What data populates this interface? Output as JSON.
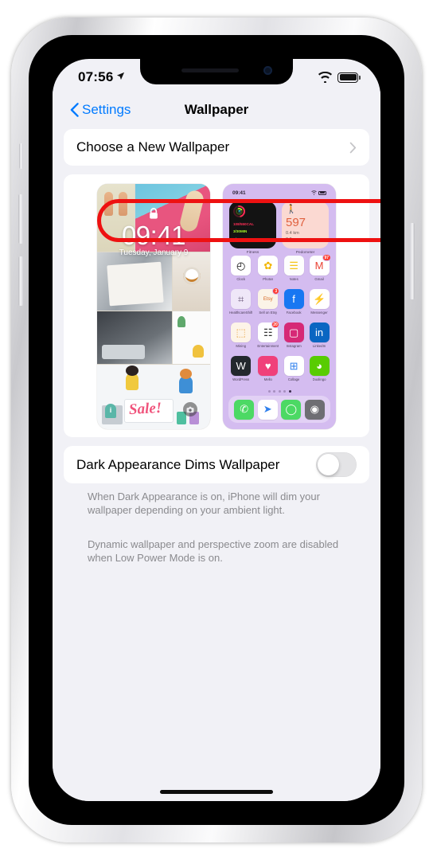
{
  "status_bar": {
    "time": "07:56",
    "location_icon": "location-arrow-icon",
    "wifi_icon": "wifi-icon",
    "battery_icon": "battery-full-icon"
  },
  "nav": {
    "back_label": "Settings",
    "back_icon": "chevron-left-icon",
    "title": "Wallpaper"
  },
  "choose_wallpaper": {
    "label": "Choose a New Wallpaper",
    "chevron_icon": "chevron-right-icon"
  },
  "lock_preview": {
    "time": "09:41",
    "date": "Tuesday, January 9",
    "lock_icon": "lock-icon",
    "camera_icon": "camera-icon",
    "sale_text": "Sale!",
    "info_badge": "i"
  },
  "home_preview": {
    "status_time": "09:41",
    "widgets": [
      {
        "name": "fitness-widget",
        "caption": "Fitness",
        "move": "108/550",
        "move_unit": "CAL",
        "exercise": "3/30",
        "exercise_unit": "MIN",
        "stand": "7/12",
        "stand_unit": "HRS"
      },
      {
        "name": "pedometer-widget",
        "caption": "Pedometer",
        "walk_icon": "walking-person-icon",
        "steps": "597",
        "distance": "0.4 km",
        "floors": "0 floors"
      }
    ],
    "apps": [
      {
        "label": "Clock",
        "icon": "clock-icon",
        "glyph": "◴",
        "bg": "#ffffff",
        "fg": "#111111",
        "badge": ""
      },
      {
        "label": "Photos",
        "icon": "photos-icon",
        "glyph": "✿",
        "bg": "#ffffff",
        "fg": "#f2b600",
        "badge": ""
      },
      {
        "label": "Notes",
        "icon": "notes-icon",
        "glyph": "☰",
        "bg": "#fdfdfd",
        "fg": "#f5c518",
        "badge": ""
      },
      {
        "label": "Gmail",
        "icon": "gmail-icon",
        "glyph": "M",
        "bg": "#ffffff",
        "fg": "#ea4335",
        "badge": "97"
      },
      {
        "label": "HealthcareShift",
        "icon": "folder-icon",
        "glyph": "⌗",
        "bg": "#efe7f8",
        "fg": "#6a5a7a",
        "badge": ""
      },
      {
        "label": "Sell on Etsy",
        "icon": "etsy-icon",
        "glyph": "Etsy",
        "bg": "#fbf4e7",
        "fg": "#d5641e",
        "badge": "3"
      },
      {
        "label": "Facebook",
        "icon": "facebook-icon",
        "glyph": "f",
        "bg": "#1877f2",
        "fg": "#ffffff",
        "badge": ""
      },
      {
        "label": "Messenger",
        "icon": "messenger-icon",
        "glyph": "⚡",
        "bg": "#ffffff",
        "fg": "#a033ff",
        "badge": ""
      },
      {
        "label": "Mining",
        "icon": "mining-icon",
        "glyph": "⬚",
        "bg": "#fdf4e8",
        "fg": "#e8a33d",
        "badge": ""
      },
      {
        "label": "Entertainment",
        "icon": "entertainment-icon",
        "glyph": "☷",
        "bg": "#ffffff",
        "fg": "#333333",
        "badge": "20"
      },
      {
        "label": "Instagram",
        "icon": "instagram-icon",
        "glyph": "▢",
        "bg": "#d62976",
        "fg": "#ffffff",
        "badge": ""
      },
      {
        "label": "LinkedIn",
        "icon": "linkedin-icon",
        "glyph": "in",
        "bg": "#0a66c2",
        "fg": "#ffffff",
        "badge": ""
      },
      {
        "label": "WordPress",
        "icon": "wordpress-icon",
        "glyph": "W",
        "bg": "#23282d",
        "fg": "#ffffff",
        "badge": ""
      },
      {
        "label": "Mello",
        "icon": "mello-icon",
        "glyph": "♥",
        "bg": "#f0407a",
        "fg": "#ffffff",
        "badge": ""
      },
      {
        "label": "Collage",
        "icon": "collage-icon",
        "glyph": "⊞",
        "bg": "#ffffff",
        "fg": "#2f80ed",
        "badge": ""
      },
      {
        "label": "Duolingo",
        "icon": "duolingo-icon",
        "glyph": "◕",
        "bg": "#58cc02",
        "fg": "#ffffff",
        "badge": ""
      }
    ],
    "page_dots": 5,
    "active_dot": 5,
    "dock": [
      {
        "label": "Phone",
        "icon": "phone-icon",
        "glyph": "✆",
        "bg": "#4cd964"
      },
      {
        "label": "Safari",
        "icon": "safari-icon",
        "glyph": "➤",
        "bg": "#ffffff"
      },
      {
        "label": "Messages",
        "icon": "messages-icon",
        "glyph": "◯",
        "bg": "#4cd964"
      },
      {
        "label": "Camera",
        "icon": "camera-icon",
        "glyph": "◉",
        "bg": "#6e6e73"
      }
    ]
  },
  "dark_appearance": {
    "label": "Dark Appearance Dims Wallpaper",
    "value": "off"
  },
  "footers": {
    "one": "When Dark Appearance is on, iPhone will dim your wallpaper depending on your ambient light.",
    "two": "Dynamic wallpaper and perspective zoom are disabled when Low Power Mode is on."
  },
  "annotation": {
    "color": "#ee1111",
    "target": "choose-wallpaper-row"
  }
}
